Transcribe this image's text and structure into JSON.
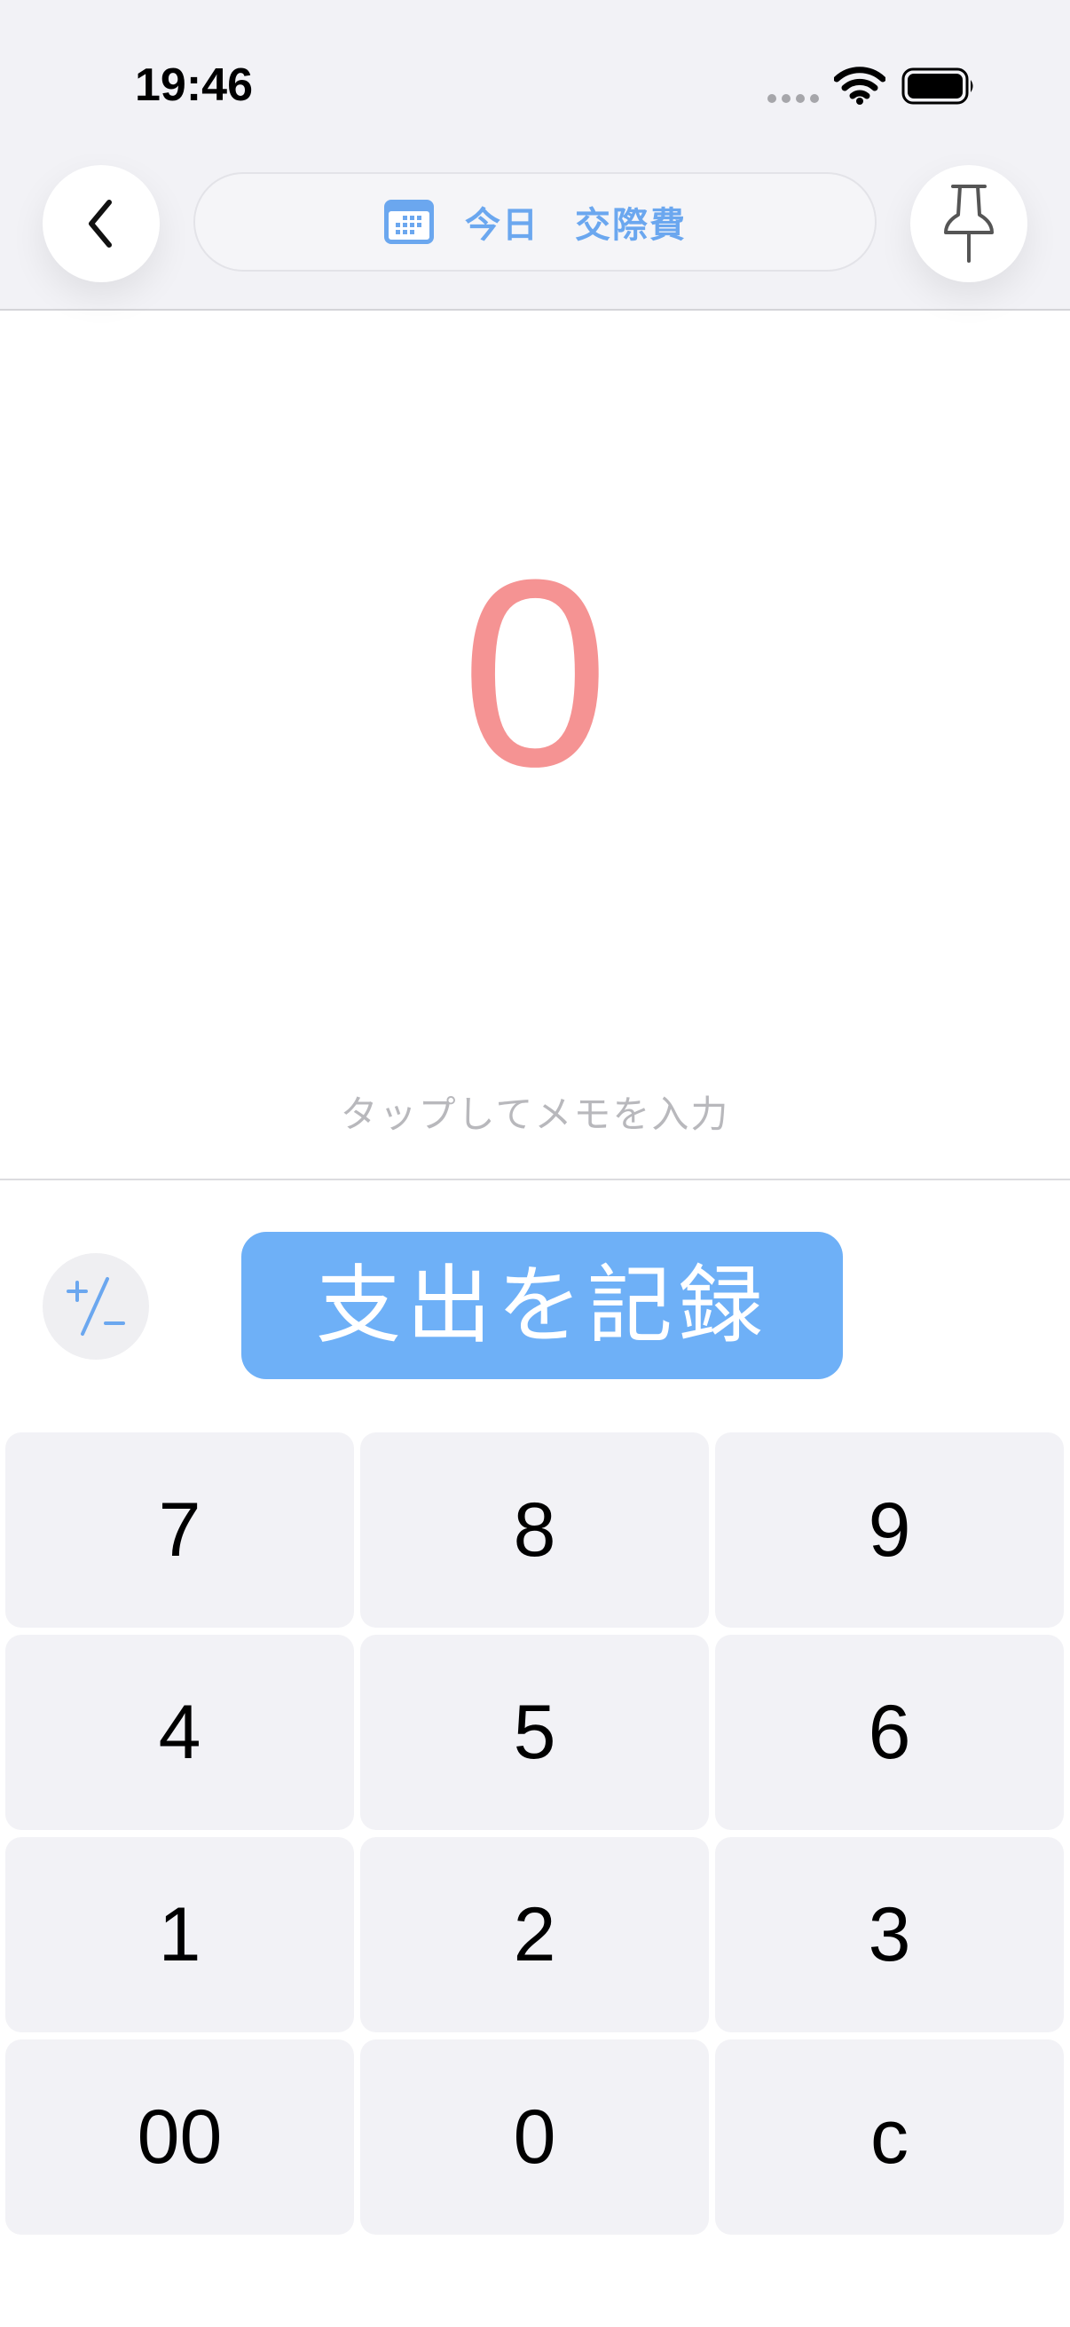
{
  "status_bar": {
    "time": "19:46",
    "signal_icon": "cellular-dots-icon",
    "wifi_icon": "wifi-icon",
    "battery_icon": "battery-full-icon"
  },
  "header": {
    "back_icon": "chevron-left-icon",
    "calendar_icon": "calendar-icon",
    "date_label": "今日",
    "category_label": "交際費",
    "pin_icon": "pushpin-icon"
  },
  "amount": {
    "value": "0",
    "color": "#f59393"
  },
  "memo": {
    "placeholder": "タップしてメモを入力"
  },
  "actions": {
    "sign_toggle_icon": "plus-minus-icon",
    "record_label": "支出を記録",
    "record_color": "#6eb0f7"
  },
  "keypad": {
    "keys": [
      "7",
      "8",
      "9",
      "4",
      "5",
      "6",
      "1",
      "2",
      "3",
      "00",
      "0",
      "c"
    ]
  },
  "colors": {
    "accent": "#6ba7ef",
    "header_background": "#f2f2f6",
    "key_background": "#f2f2f6"
  }
}
